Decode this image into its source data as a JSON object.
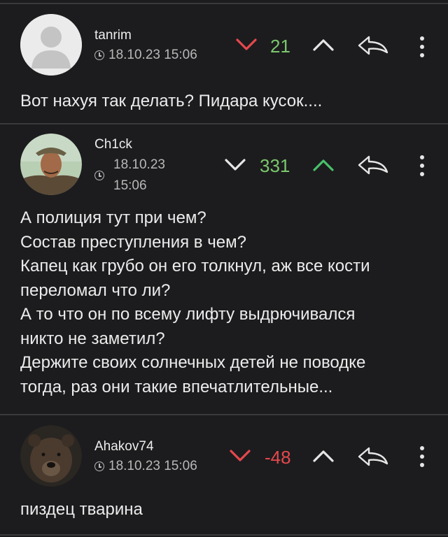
{
  "colors": {
    "background": "#1c1c1e",
    "divider": "#3a3a3c",
    "upvote_active": "#49c16a",
    "downvote_active": "#e5484d",
    "positive_score": "#7bc86c",
    "negative_score": "#e5484d",
    "neutral_icon": "#e6e6e6"
  },
  "comments": [
    {
      "username": "tanrim",
      "date": "18.10.23 15:06",
      "score": "21",
      "vote_state": "down",
      "avatar": "default-avatar-icon",
      "lines": [
        "Вот нахуя так делать? Пидара кусок...."
      ]
    },
    {
      "username": "Ch1ck",
      "date_line1": "18.10.23",
      "date_line2": "15:06",
      "score": "331",
      "vote_state": "up",
      "avatar": "man-in-hat-avatar",
      "lines": [
        "А полиция тут при чем?",
        "Состав преступления в чем?",
        "Капец как грубо он его толкнул, аж все кости",
        "переломал что ли?",
        "А то что он по всему лифту выдрючивался",
        "никто не заметил?",
        "Держите своих солнечных детей не поводке",
        "тогда, раз они такие впечатлительные..."
      ]
    },
    {
      "username": "Ahakov74",
      "date": "18.10.23 15:06",
      "score": "-48",
      "vote_state": "down",
      "avatar": "bear-avatar",
      "lines": [
        "пиздец тварина"
      ]
    }
  ]
}
